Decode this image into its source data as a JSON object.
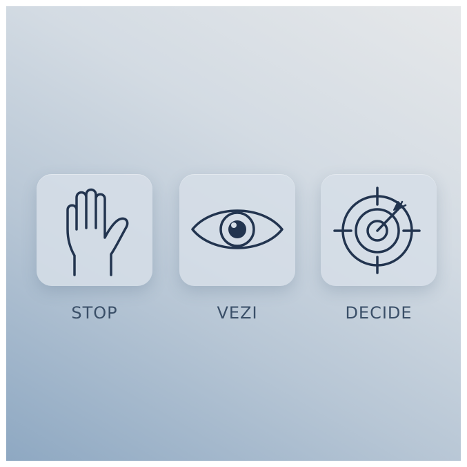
{
  "items": [
    {
      "label": "STOP",
      "icon": "hand-stop-icon"
    },
    {
      "label": "VEZI",
      "icon": "eye-icon"
    },
    {
      "label": "DECIDE",
      "icon": "target-icon"
    }
  ],
  "colors": {
    "icon_stroke": "#22344f",
    "label_text": "#3a4f68",
    "tile_fill": "#d6dee7"
  }
}
